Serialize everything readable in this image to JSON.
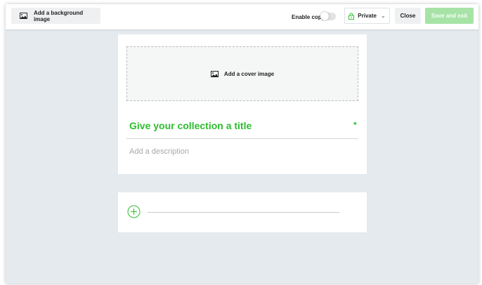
{
  "toolbar": {
    "background_button_label": "Add a background image",
    "enable_copy_label": "Enable copy",
    "privacy_label": "Private",
    "close_label": "Close",
    "save_label": "Save and exit"
  },
  "collection": {
    "cover_label": "Add a cover image",
    "title_placeholder": "Give your collection a title",
    "required_marker": "*",
    "description_placeholder": "Add a description"
  },
  "colors": {
    "accent_green": "#2dbd2d",
    "save_disabled": "#a7e3a7",
    "canvas": "#e4eaee"
  }
}
